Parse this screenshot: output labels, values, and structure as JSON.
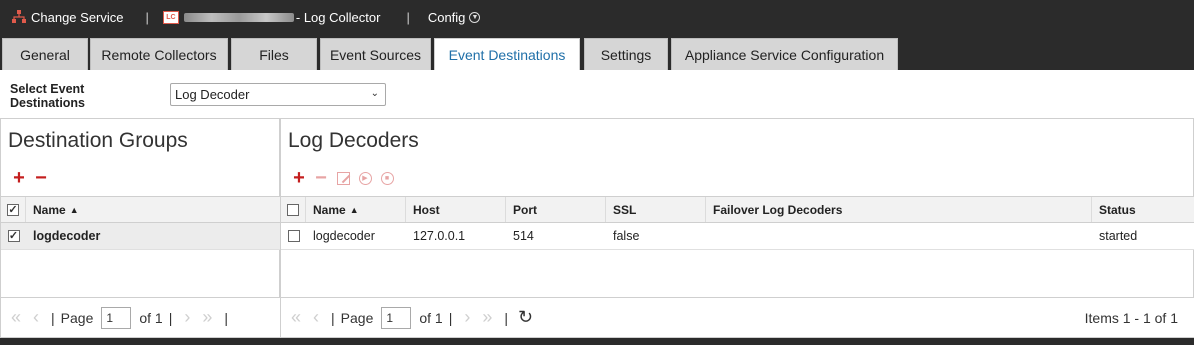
{
  "header": {
    "change_service": "Change Service",
    "separator": "|",
    "lc_badge": "LC",
    "service_suffix": "- Log Collector",
    "config": "Config"
  },
  "tabs": [
    {
      "label": "General"
    },
    {
      "label": "Remote Collectors"
    },
    {
      "label": "Files"
    },
    {
      "label": "Event Sources"
    },
    {
      "label": "Event Destinations",
      "active": true
    },
    {
      "label": "Settings"
    },
    {
      "label": "Appliance Service Configuration"
    }
  ],
  "select": {
    "label": "Select Event Destinations",
    "value": "Log Decoder"
  },
  "left_panel": {
    "title": "Destination Groups",
    "columns": {
      "name": "Name"
    },
    "rows": [
      {
        "name": "logdecoder",
        "checked": true
      }
    ],
    "pager": {
      "page_label": "Page",
      "page": "1",
      "of": "of 1"
    }
  },
  "right_panel": {
    "title": "Log Decoders",
    "columns": {
      "name": "Name",
      "host": "Host",
      "port": "Port",
      "ssl": "SSL",
      "failover": "Failover Log Decoders",
      "status": "Status"
    },
    "rows": [
      {
        "name": "logdecoder",
        "host": "127.0.0.1",
        "port": "514",
        "ssl": "false",
        "failover": "",
        "status": "started"
      }
    ],
    "pager": {
      "page_label": "Page",
      "page": "1",
      "of": "of 1",
      "items": "Items 1 - 1 of 1"
    }
  },
  "colors": {
    "topbar": "#2b2b2b",
    "active_tab_text": "#1f6fa8",
    "accent_red": "#c41e1e"
  }
}
